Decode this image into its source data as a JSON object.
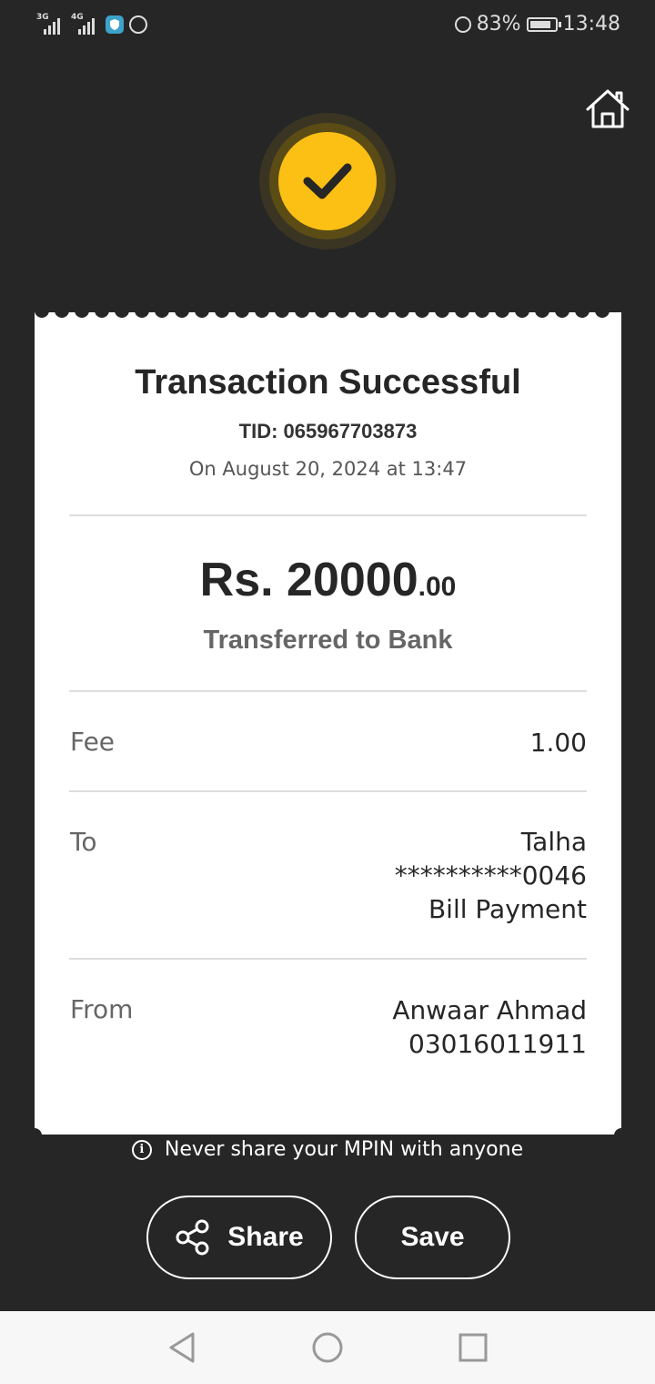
{
  "status_bar": {
    "network_1": "3G",
    "network_2": "4G",
    "battery_percent": "83%",
    "time": "13:48"
  },
  "receipt": {
    "title": "Transaction Successful",
    "tid": "TID: 065967703873",
    "date": "On August 20, 2024 at 13:47",
    "amount_main": "Rs. 20000",
    "amount_decimal": ".00",
    "transfer_type": "Transferred to Bank",
    "fee": {
      "label": "Fee",
      "value": "1.00"
    },
    "to": {
      "label": "To",
      "name": "Talha",
      "account": "**********0046",
      "type": "Bill Payment"
    },
    "from": {
      "label": "From",
      "name": "Anwaar Ahmad",
      "phone": "03016011911"
    }
  },
  "footer": {
    "security_note": "Never share your MPIN with anyone",
    "share_label": "Share",
    "save_label": "Save"
  },
  "icons": {
    "home": "home-icon",
    "success": "check-icon",
    "info": "info-icon",
    "share": "share-icon"
  },
  "colors": {
    "background": "#262626",
    "accent": "#fcc014",
    "card": "#ffffff"
  }
}
